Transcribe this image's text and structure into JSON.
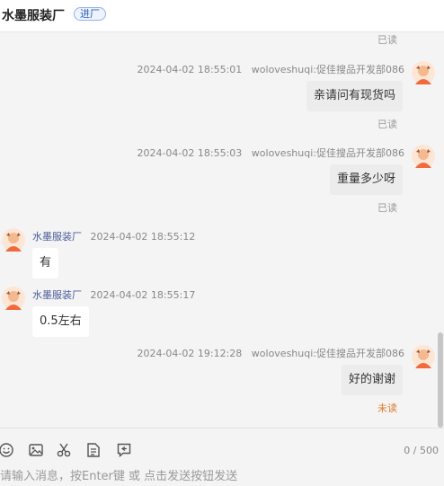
{
  "header": {
    "title": "水墨服装厂",
    "tag": "进厂"
  },
  "messages": [
    {
      "read_status": "已读"
    },
    {
      "time": "2024-04-02 18:55:01",
      "sender": "woloveshuqi:促佳搜品开发部086",
      "text": "亲请问有现货吗",
      "status": "已读"
    },
    {
      "time": "2024-04-02 18:55:03",
      "sender": "woloveshuqi:促佳搜品开发部086",
      "text": "重量多少呀",
      "status": "已读"
    },
    {
      "sender": "水墨服装厂",
      "time": "2024-04-02 18:55:12",
      "text": "有"
    },
    {
      "sender": "水墨服装厂",
      "time": "2024-04-02 18:55:17",
      "text": "0.5左右"
    },
    {
      "time": "2024-04-02 19:12:28",
      "sender": "woloveshuqi:促佳搜品开发部086",
      "text": "好的谢谢",
      "status": "未读"
    }
  ],
  "composer": {
    "counter": "0 / 500",
    "placeholder": "请输入消息，按Enter键 或 点击发送按钮发送",
    "tools": [
      "emoji-icon",
      "image-icon",
      "scissors-icon",
      "document-icon",
      "quick-reply-icon"
    ]
  },
  "colors": {
    "unread": "#e07b2a",
    "tag_border": "#8fb2e6",
    "tag_text": "#2d5fb3"
  }
}
